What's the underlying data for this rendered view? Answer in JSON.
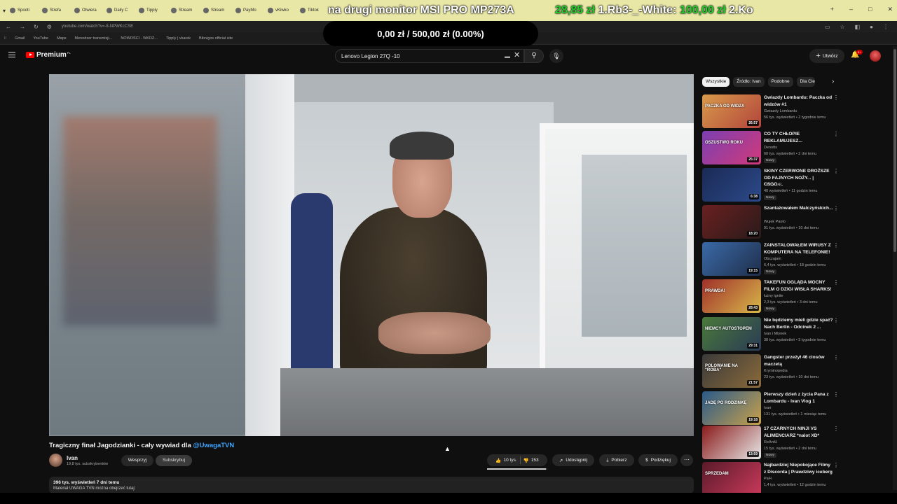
{
  "browser": {
    "tabs": [
      "Spooti",
      "Strefa",
      "Otwiera",
      "Daily C",
      "Tipply",
      "Stream",
      "Stream",
      "PayMo",
      "vKiwko",
      "Tiktok",
      "Down"
    ],
    "url": "youtube.com/watch?v=-8-NPWKcCSE",
    "bookmarks": [
      "Gmail",
      "YouTube",
      "Maps",
      "Menedzer transmisji...",
      "NOWOŚCI - WKDZ...",
      "Tipply | vkarek",
      "Bibnigos official site"
    ]
  },
  "overlay": {
    "marquee_text": "na drugi monitor MSI PRO MP273A",
    "right_prefix": "",
    "right_amount1": "28,85 zł",
    "right_text1": "1.Rb3-_-White:",
    "right_amount2": "100,00 zł",
    "right_text2": "2.Ko",
    "donation_goal": "0,00 zł  /  500,00 zł (0.00%)"
  },
  "header": {
    "logo_text": "Premium",
    "logo_sup": "PL",
    "search_value": "Lenovo Legion 27Q -10",
    "create_label": "Utwórz",
    "notifications_count": "9+"
  },
  "video": {
    "title_prefix": "Tragiczny finał Jagodzianki - cały wywiad dla ",
    "title_mention": "@UwagaTVN",
    "channel_name": "Ivan",
    "channel_subs": "19,8 tys. subskrybentów",
    "support_label": "Wesprzyj",
    "subscribe_label": "Subskrybuj",
    "likes": "10 tys.",
    "dislikes": "153",
    "like_ratio": 0.98,
    "share_label": "Udostępnij",
    "download_label": "Pobierz",
    "thanks_label": "Podziękuj",
    "description_meta": "396 tys. wyświetleń  7 dni temu",
    "description_text": "Materiał UWAGA TVN można obejrzeć tutaj:"
  },
  "sidebar": {
    "chips": [
      "Wszystkie",
      "Źródło: Ivan",
      "Podobne",
      "Dla Ciebie"
    ],
    "recommendations": [
      {
        "title": "Gwiazdy Lombardu: Paczka od widzów #1",
        "channel": "Gwiazdy Lombardu",
        "views": "56 tys. wyświetleń • 2 tygodnie temu",
        "duration": "26:57",
        "badge": "",
        "thumb": [
          "#d99a4a",
          "#b2453c"
        ],
        "thumb_text": "PACZKA OD WIDZA"
      },
      {
        "title": "CO TY CHŁOPIE REKLAMUJESZ...",
        "channel": "Denotts",
        "views": "60 tys. wyświetleń • 2 dni temu",
        "duration": "25:37",
        "badge": "Nowy",
        "thumb": [
          "#7b3fb2",
          "#d13a7a"
        ],
        "thumb_text": "OSZUSTWO ROKU"
      },
      {
        "title": "SKINY CZERWONE DROŻSZE OD FAJNYCH NOŻY... | CSGO-...",
        "channel": "T&S_CUP",
        "views": "40 wyświetleń • 11 godzin temu",
        "duration": "6:38",
        "badge": "Nowy",
        "thumb": [
          "#1a2a55",
          "#2c4a8a"
        ],
        "thumb_text": ""
      },
      {
        "title": "Szantażowałem Malczyńskich...",
        "channel": "Wujek Paolo",
        "views": "91 tys. wyświetleń • 10 dni temu",
        "duration": "18:20",
        "badge": "",
        "thumb": [
          "#6a2020",
          "#2a1a1a"
        ],
        "thumb_text": ""
      },
      {
        "title": "ZAINSTALOWAŁEM WIRUSY Z KOMPUTERA NA TELEFONIE!",
        "channel": "Obczajam",
        "views": "6,4 tys. wyświetleń • 18 godzin temu",
        "duration": "19:15",
        "badge": "Nowy",
        "thumb": [
          "#3a6aa8",
          "#1f2e4a"
        ],
        "thumb_text": ""
      },
      {
        "title": "TAKEFUN OGLĄDA MOCNY FILM O DZIGI WISŁA SHARKS!",
        "channel": "lużny ignite",
        "views": "2,3 tys. wyświetleń • 3 dni temu",
        "duration": "28:43",
        "badge": "Nowy",
        "thumb": [
          "#a0302a",
          "#d8b84a"
        ],
        "thumb_text": "PRAWDA!"
      },
      {
        "title": "Nie będziemy mieli gdzie spać? Nach Berlin - Odcinek 2 ...",
        "channel": "Ivan i Mlynek",
        "views": "38 tys. wyświetleń • 3 tygodnie temu",
        "duration": "29:31",
        "badge": "",
        "thumb": [
          "#4a7a3a",
          "#2a3a55"
        ],
        "thumb_text": "NIEMCY AUTOSTOPEM"
      },
      {
        "title": "Gangster przeżył 46 ciosów maczetą",
        "channel": "Kryminopedia",
        "views": "23 tys. wyświetleń • 10 dni temu",
        "duration": "21:57",
        "badge": "",
        "thumb": [
          "#3a3a3a",
          "#8a6a3a"
        ],
        "thumb_text": "POLOWANIE NA \"ROBA\""
      },
      {
        "title": "Pierwszy dzień z życia Pana z Lombardu - Ivan Vlog 1",
        "channel": "Ivan",
        "views": "131 tys. wyświetleń • 1 miesiąc temu",
        "duration": "19:18",
        "badge": "",
        "thumb": [
          "#2a5a8a",
          "#c8a04a"
        ],
        "thumb_text": "JADĘ PO RODZINKĘ"
      },
      {
        "title": "17 CZARNYCH NINJI VS ALIMENCIARZ *nalot XD*",
        "channel": "ReAntU",
        "views": "15 tys. wyświetleń • 2 dni temu",
        "duration": "13:59",
        "badge": "Nowy",
        "thumb": [
          "#8a1a1a",
          "#e8e8e8"
        ],
        "thumb_text": ""
      },
      {
        "title": "Najbardziej Niepokojące Filmy z Discorda | Prawdziwy iceberg",
        "channel": "PaFi",
        "views": "1,4 tys. wyświetleń • 12 godzin temu",
        "duration": "",
        "badge": "",
        "thumb": [
          "#5a1a2a",
          "#c83a5a"
        ],
        "thumb_text": "SPRZEDAM"
      }
    ]
  }
}
